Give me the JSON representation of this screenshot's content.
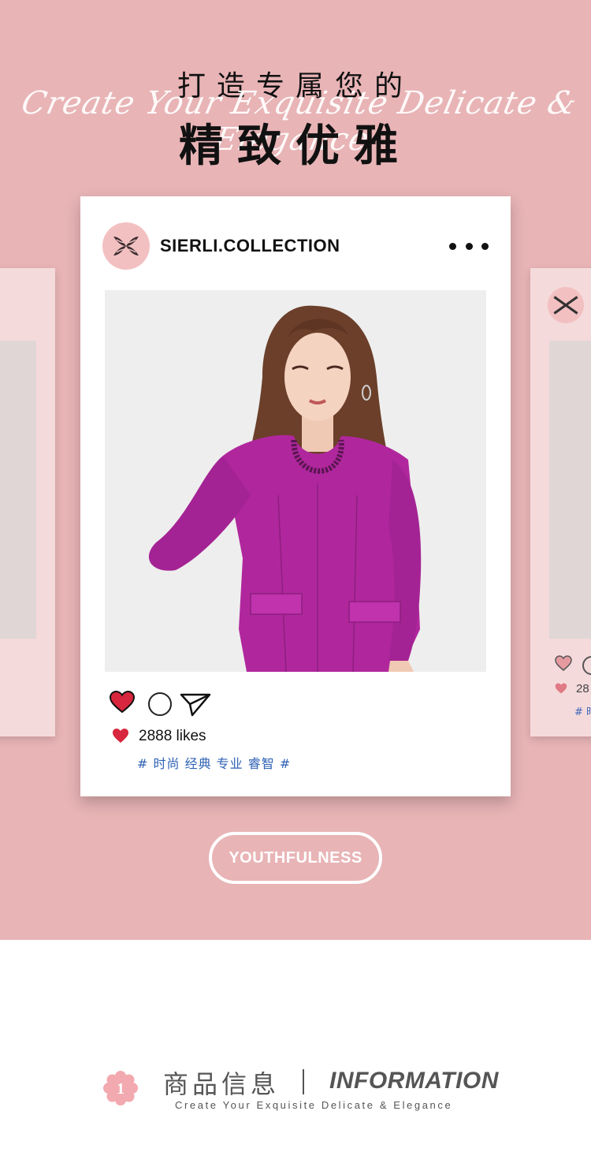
{
  "hero": {
    "headline_top": "打造专属您的",
    "script_line": "Create Your Exquisite Delicate & Elegance",
    "headline_main": "精致优雅",
    "background_color": "#e8b4b6"
  },
  "post": {
    "account_name": "SIERLI.COLLECTION",
    "more_icon": "more-dots-icon",
    "likes": "2888 likes",
    "hashtags": "# 时尚 经典 专业 睿智 #",
    "like_color": "#d7263d",
    "hashtag_color": "#2f62b5"
  },
  "side_card_right": {
    "likes_partial": "28",
    "tag_partial": "# 时"
  },
  "cta": {
    "label": "YOUTHFULNESS"
  },
  "info": {
    "badge_number": "1",
    "title_cn": "商品信息",
    "title_en": "INFORMATION",
    "subtitle": "Create Your Exquisite Delicate & Elegance"
  }
}
